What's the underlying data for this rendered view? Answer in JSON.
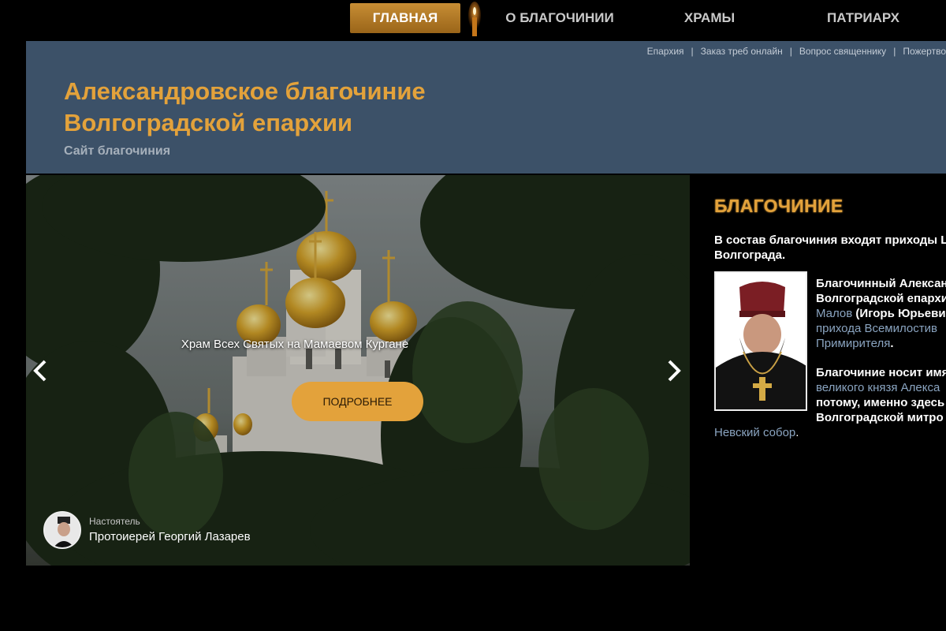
{
  "nav": {
    "items": [
      {
        "label": "ГЛАВНАЯ",
        "active": true
      },
      {
        "label": "О БЛАГОЧИНИИ",
        "active": false
      },
      {
        "label": "ХРАМЫ",
        "active": false
      },
      {
        "label": "ПАТРИАРХ",
        "active": false
      }
    ],
    "accent": "#c78d34"
  },
  "header": {
    "links": [
      "Епархия",
      "Заказ треб онлайн",
      "Вопрос священнику",
      "Пожертво"
    ],
    "separator": "|",
    "title": "Александровское благочиние Волгоградской епархии",
    "subtitle": "Сайт благочиния",
    "background": "#3c5168",
    "title_color": "#e3a23b"
  },
  "slider": {
    "caption": "Храм Всех Святых на Мамаевом Кургане",
    "button_label": "ПОДРОБНЕЕ",
    "prev_icon": "chevron-left-icon",
    "next_icon": "chevron-right-icon",
    "rector": {
      "role": "Настоятель",
      "name": "Протоиерей Георгий Лазарев"
    }
  },
  "side": {
    "title": "БЛАГОЧИНИЕ",
    "intro": "В состав благочиния входят приходы Ц Волгограда.",
    "intro_lines": [
      "В состав благочиния входят приходы Ц",
      "Волгограда."
    ],
    "para1": {
      "line1": "Благочинный Алексан",
      "line2": "Волгоградской епархи",
      "link": "Малов",
      "line3_rest": " (Игорь Юрьеви",
      "link2": "прихода Всемилостив",
      "link3": "Примирителя",
      "line5_rest": "."
    },
    "para2": {
      "line1": "Благочиние носит имя",
      "link": "великого князя Алекса",
      "line3": "потому, именно здесь",
      "line4": "Волгоградской митро"
    },
    "tail": {
      "link": "Невский собор",
      "rest": "."
    }
  }
}
